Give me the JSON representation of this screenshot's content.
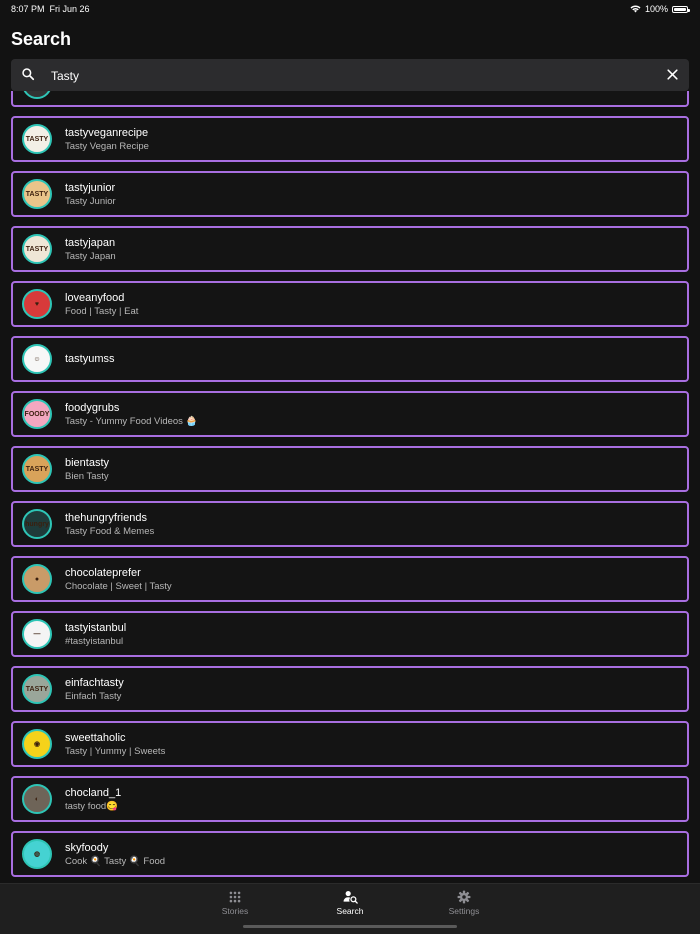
{
  "status": {
    "time": "8:07 PM",
    "date": "Fri Jun 26",
    "battery": "100%"
  },
  "page": {
    "title": "Search"
  },
  "search": {
    "value": "Tasty",
    "placeholder": "Search"
  },
  "results": [
    {
      "username": "",
      "subtitle": "",
      "avatar_bg": "#333333",
      "avatar_text": ""
    },
    {
      "username": "tastyveganrecipe",
      "subtitle": "Tasty Vegan Recipe",
      "avatar_bg": "#f3efe6",
      "avatar_text": "TASTY"
    },
    {
      "username": "tastyjunior",
      "subtitle": "Tasty Junior",
      "avatar_bg": "#e9c48a",
      "avatar_text": "TASTY"
    },
    {
      "username": "tastyjapan",
      "subtitle": "Tasty Japan",
      "avatar_bg": "#efe6d6",
      "avatar_text": "TASTY"
    },
    {
      "username": "loveanyfood",
      "subtitle": "Food | Tasty | Eat",
      "avatar_bg": "#d83a3a",
      "avatar_text": "♥"
    },
    {
      "username": "tastyumss",
      "subtitle": "",
      "avatar_bg": "#f7f7f7",
      "avatar_text": "☺"
    },
    {
      "username": "foodygrubs",
      "subtitle": "Tasty - Yummy Food Videos 🧁",
      "avatar_bg": "#f2a7c0",
      "avatar_text": "FOODY"
    },
    {
      "username": "bientasty",
      "subtitle": "Bien Tasty",
      "avatar_bg": "#d9a35a",
      "avatar_text": "TASTY"
    },
    {
      "username": "thehungryfriends",
      "subtitle": "Tasty Food & Memes",
      "avatar_bg": "#1f3b3a",
      "avatar_text": "hungry"
    },
    {
      "username": "chocolateprefer",
      "subtitle": "Chocolate | Sweet | Tasty",
      "avatar_bg": "#c99b68",
      "avatar_text": "●"
    },
    {
      "username": "tastyistanbul",
      "subtitle": "#tastyistanbul",
      "avatar_bg": "#f4f4f4",
      "avatar_text": "—"
    },
    {
      "username": "einfachtasty",
      "subtitle": "Einfach Tasty",
      "avatar_bg": "#9aa69a",
      "avatar_text": "TASTY"
    },
    {
      "username": "sweettaholic",
      "subtitle": "Tasty | Yummy | Sweets",
      "avatar_bg": "#f5d21a",
      "avatar_text": "◉"
    },
    {
      "username": "chocland_1",
      "subtitle": "tasty food😋",
      "avatar_bg": "#6e6458",
      "avatar_text": "◐"
    },
    {
      "username": "skyfoody",
      "subtitle": "Cook 🍳 Tasty 🍳 Food",
      "avatar_bg": "#45d2d2",
      "avatar_text": "◍"
    }
  ],
  "tabs": [
    {
      "label": "Stories",
      "icon": "grid-icon",
      "active": false
    },
    {
      "label": "Search",
      "icon": "person-search-icon",
      "active": true
    },
    {
      "label": "Settings",
      "icon": "gear-icon",
      "active": false
    }
  ],
  "colors": {
    "accent_border": "#a86ee0",
    "avatar_ring": "#2ec5b6",
    "background": "#121212"
  }
}
